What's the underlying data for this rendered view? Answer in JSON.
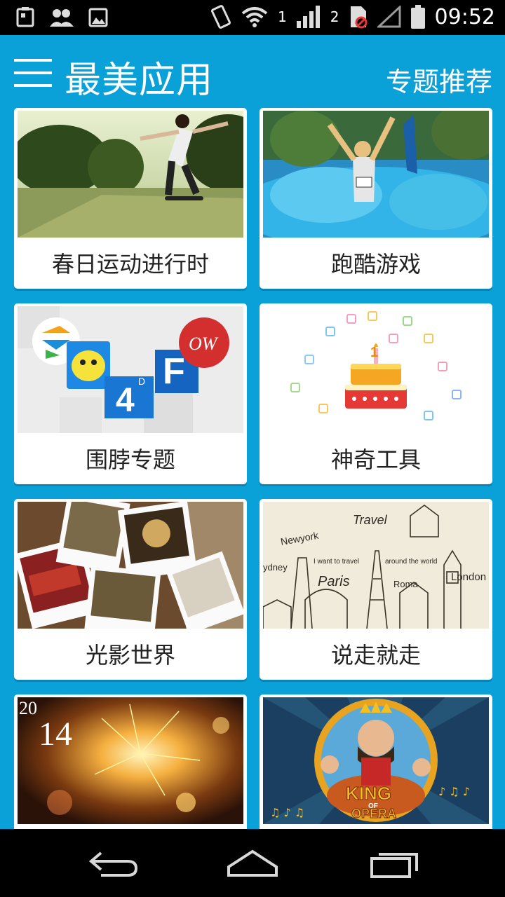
{
  "status_bar": {
    "sim1_label": "1",
    "sim2_label": "2",
    "time": "09:52"
  },
  "app_bar": {
    "title": "最美应用",
    "right_link": "专题推荐"
  },
  "topics": [
    {
      "label": "春日运动进行时",
      "image": "skateboard-photo"
    },
    {
      "label": "跑酷游戏",
      "image": "color-run-photo"
    },
    {
      "label": "围脖专题",
      "image": "app-icons-collage"
    },
    {
      "label": "神奇工具",
      "image": "birthday-cake-icons"
    },
    {
      "label": "光影世界",
      "image": "polaroid-photos"
    },
    {
      "label": "说走就走",
      "image": "travel-landmarks"
    },
    {
      "label": "",
      "image": "fireworks-2014"
    },
    {
      "label": "",
      "image": "king-of-opera-game"
    }
  ],
  "travel_art": {
    "travel": "Travel",
    "newyork": "Newyork",
    "sydney": "ydney",
    "want": "I want to travel",
    "around": "around the world",
    "paris": "Paris",
    "roma": "Roma",
    "london": "London"
  },
  "fireworks_art": {
    "year_top": "20",
    "year_bottom": "14"
  },
  "opera_art": {
    "king": "KING",
    "of": "OF",
    "opera": "OPERA"
  },
  "collage_art": {
    "four": "4",
    "four_sup": "D",
    "f": "F",
    "ow": "OW"
  },
  "cake_art": {
    "candle": "1"
  },
  "colors": {
    "accent": "#0aa0d8",
    "status_bar": "#000000",
    "card_bg": "#ffffff",
    "label_text": "#222222"
  },
  "nav_bar": {
    "back": "back-icon",
    "home": "home-icon",
    "recents": "recents-icon"
  }
}
